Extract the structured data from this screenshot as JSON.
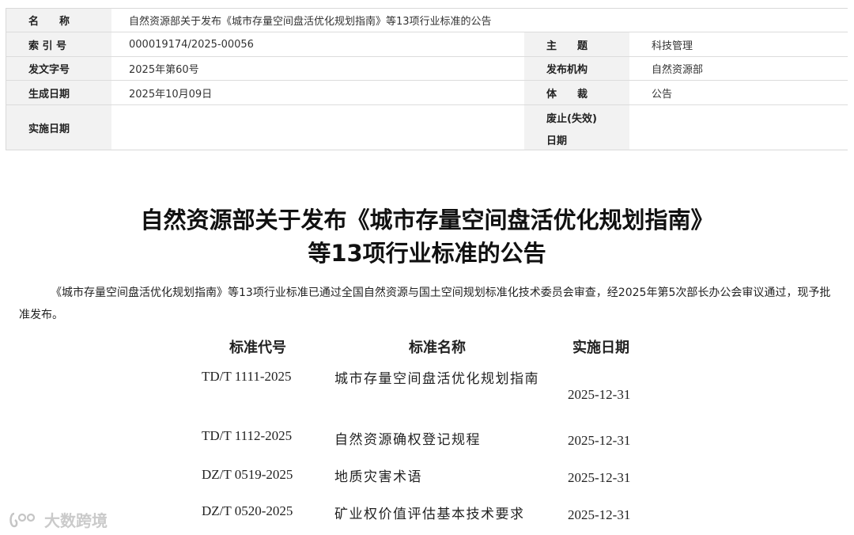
{
  "meta": {
    "name_label": "名　　称",
    "name_value": "自然资源部关于发布《城市存量空间盘活优化规划指南》等13项行业标准的公告",
    "index_label": "索 引 号",
    "index_value": "000019174/2025-00056",
    "topic_label": "主　　题",
    "topic_value": "科技管理",
    "docno_label": "发文字号",
    "docno_value": "2025年第60号",
    "issuer_label": "发布机构",
    "issuer_value": "自然资源部",
    "created_label": "生成日期",
    "created_value": "2025年10月09日",
    "genre_label": "体　　裁",
    "genre_value": "公告",
    "effective_label": "实施日期",
    "effective_value": "",
    "repeal_label_1": "废止(失效)",
    "repeal_label_2": "日期",
    "repeal_value": ""
  },
  "article": {
    "title_line1": "自然资源部关于发布《城市存量空间盘活优化规划指南》",
    "title_line2": "等13项行业标准的公告",
    "body": "《城市存量空间盘活优化规划指南》等13项行业标准已通过全国自然资源与国土空间规划标准化技术委员会审查，经2025年第5次部长办公会审议通过，现予批准发布。"
  },
  "standards": {
    "headers": {
      "code": "标准代号",
      "name": "标准名称",
      "date": "实施日期"
    },
    "rows": [
      {
        "code": "TD/T 1111-2025",
        "name": "城市存量空间盘活优化规划指南",
        "date": "2025-12-31"
      },
      {
        "code": "TD/T 1112-2025",
        "name": "自然资源确权登记规程",
        "date": "2025-12-31"
      },
      {
        "code": "DZ/T 0519-2025",
        "name": "地质灾害术语",
        "date": "2025-12-31"
      },
      {
        "code": "DZ/T 0520-2025",
        "name": "矿业权价值评估基本技术要求",
        "date": "2025-12-31"
      }
    ]
  },
  "watermark": {
    "text": "大数跨境"
  }
}
